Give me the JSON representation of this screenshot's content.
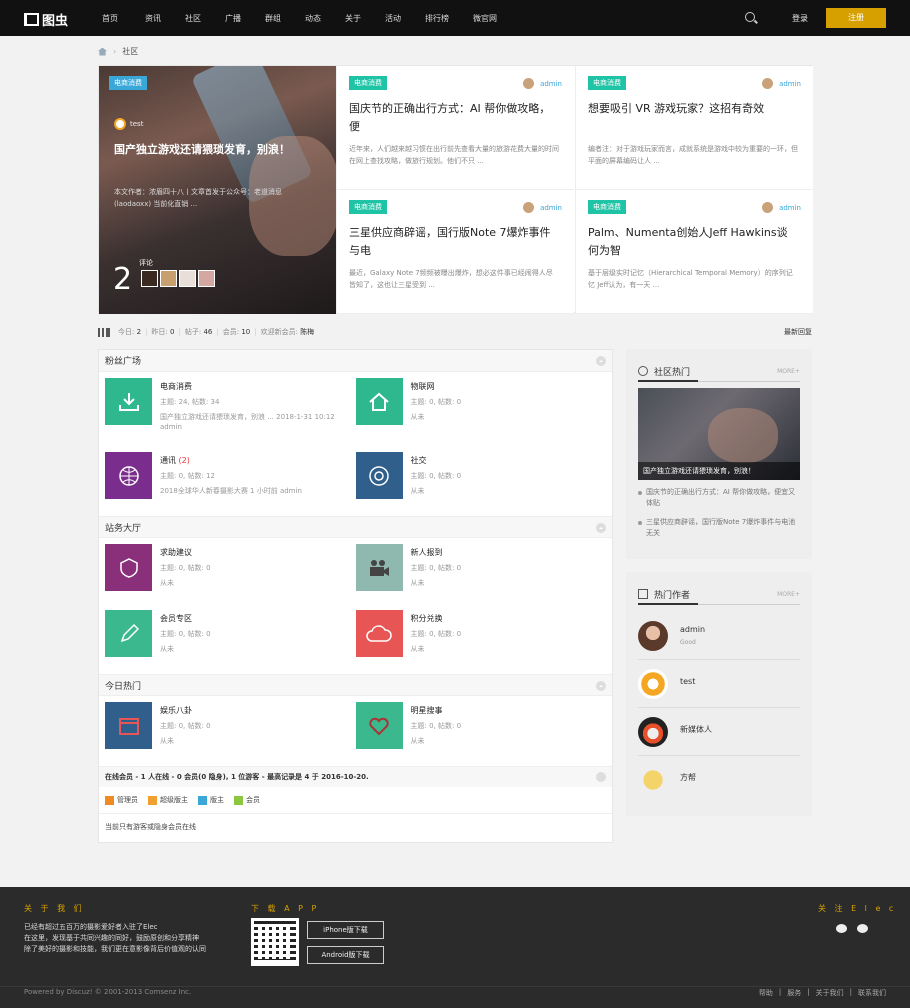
{
  "logo": "图虫",
  "nav": [
    "首页",
    "资讯",
    "社区",
    "广播",
    "群组",
    "动态",
    "关于",
    "活动",
    "排行榜",
    "微官网"
  ],
  "header": {
    "login": "登录",
    "register": "注册"
  },
  "breadcrumb": "社区",
  "hero": {
    "big": {
      "tag": "电商消费",
      "author": "test",
      "title": "国产独立游戏还请猥琐发育，别浪！",
      "desc": "本文作者：浓眉四十八丨文章首发于公众号：老道消息(laodaoxx) 当前化直销 ...",
      "comment_count": "2",
      "comment_label": "评论"
    },
    "cards": [
      {
        "tag": "电商消费",
        "user": "admin",
        "title": "国庆节的正确出行方式：AI 帮你做攻略，便",
        "desc": "近年来，人们越来越习惯在出行前先查看大量的旅游花费大量的时间在网上查找攻略，做旅行规划。他们不只 ..."
      },
      {
        "tag": "电商消费",
        "user": "admin",
        "title": "想要吸引 VR 游戏玩家？这招有奇效",
        "desc": "编者注：对于游戏玩家而言，成就系统是游戏中较为重要的一环，但平面的屏幕编码让人 ..."
      },
      {
        "tag": "电商消费",
        "user": "admin",
        "title": "三星供应商辟谣，国行版Note 7爆炸事件与电",
        "desc": "最近，Galaxy Note 7频频被曝出爆炸，想必这件事已经闹得人尽皆知了，这也让三星受到 ..."
      },
      {
        "tag": "电商消费",
        "user": "admin",
        "title": "Palm、Numenta创始人Jeff Hawkins谈何为智",
        "desc": "基于层级实时记忆（Hierarchical Temporal Memory）的序列记忆 Jeff认为，有一天 ..."
      }
    ]
  },
  "stats": {
    "today_label": "今日:",
    "today": "2",
    "yesterday_label": "昨日:",
    "yesterday": "0",
    "posts_label": "帖子:",
    "posts": "46",
    "members_label": "会员:",
    "members": "10",
    "welcome_label": "欢迎新会员:",
    "newest": "陈梅",
    "latest_reply": "最新回复"
  },
  "sections": [
    {
      "title": "粉丝广场",
      "forums": [
        {
          "name": "电商消费",
          "count": "",
          "meta": "主题: 24, 帖数: 34",
          "last": "国产独立游戏还请猥琐发育，别浪 ... 2018-1-31 10:12 admin",
          "color": "#2fb88e",
          "icon": "download-icon"
        },
        {
          "name": "物联网",
          "count": "",
          "meta": "主题: 0, 帖数: 0",
          "last": "从未",
          "color": "#2fb88e",
          "icon": "home-icon"
        },
        {
          "name": "通讯",
          "count": "(2)",
          "meta": "主题: 0, 帖数: 12",
          "last": "2018全球华人新春摄影大赛 1 小时前 admin",
          "color": "#7b2d8e",
          "icon": "globe-icon"
        },
        {
          "name": "社交",
          "count": "",
          "meta": "主题: 0, 帖数: 0",
          "last": "从未",
          "color": "#2f5f8a",
          "icon": "at-icon"
        }
      ]
    },
    {
      "title": "站务大厅",
      "forums": [
        {
          "name": "求助建议",
          "count": "",
          "meta": "主题: 0, 帖数: 0",
          "last": "从未",
          "color": "#8a2f7a",
          "icon": "heart-shield-icon"
        },
        {
          "name": "新人报到",
          "count": "",
          "meta": "主题: 0, 帖数: 0",
          "last": "从未",
          "color": "#8fb8ae",
          "icon": "camera-icon"
        },
        {
          "name": "会员专区",
          "count": "",
          "meta": "主题: 0, 帖数: 0",
          "last": "从未",
          "color": "#3bb88e",
          "icon": "pencil-icon"
        },
        {
          "name": "积分兑换",
          "count": "",
          "meta": "主题: 0, 帖数: 0",
          "last": "从未",
          "color": "#e85555",
          "icon": "cloud-icon"
        }
      ]
    },
    {
      "title": "今日热门",
      "forums": [
        {
          "name": "娱乐八卦",
          "count": "",
          "meta": "主题: 0, 帖数: 0",
          "last": "从未",
          "color": "#2f5f8a",
          "icon": "calendar-icon"
        },
        {
          "name": "明星搜事",
          "count": "",
          "meta": "主题: 0, 帖数: 0",
          "last": "从未",
          "color": "#3bb88e",
          "icon": "heart-icon"
        }
      ]
    }
  ],
  "online": {
    "summary": "在线会员 - 1 人在线 - 0 会员(0 隐身), 1 位游客 - 最高记录是 4 于 2016-10-20.",
    "legend": [
      {
        "label": "管理员",
        "color": "#f08a24"
      },
      {
        "label": "超级版主",
        "color": "#f0a030"
      },
      {
        "label": "版主",
        "color": "#3aa7d9"
      },
      {
        "label": "会员",
        "color": "#8cc63f"
      }
    ],
    "note": "当前只有游客或隐身会员在线"
  },
  "hot": {
    "title": "社区热门",
    "more": "MORE+",
    "image_caption": "国产独立游戏还请猥琐发育，别浪！",
    "items": [
      "国庆节的正确出行方式：AI 帮你做攻略，便宜又体贴",
      "三星供应商辟谣，国行版Note 7爆炸事件与电池无关"
    ]
  },
  "authors": {
    "title": "热门作者",
    "more": "MORE+",
    "list": [
      {
        "name": "admin",
        "sub": "Good"
      },
      {
        "name": "test",
        "sub": ""
      },
      {
        "name": "新媒体人",
        "sub": ""
      },
      {
        "name": "方帮",
        "sub": ""
      }
    ]
  },
  "footer": {
    "about_title": "关 于 我 们",
    "about_lines": [
      "已经有超过五百万的摄影爱好者入驻了Elec",
      "在这里，发现基于共同兴趣的同好，鼓励原创和分享精神",
      "除了美好的摄影和技能，我们更在意影像背后价值观的认同"
    ],
    "app_title": "下 载 A P P",
    "iphone": "iPhone版下载",
    "android": "Android版下载",
    "follow_title": "关 注 E l e c",
    "copyright": "Powered by Discuz! © 2001-2013 Comsenz Inc.",
    "links": [
      "帮助",
      "|",
      "服务",
      "|",
      "关于我们",
      "|",
      "联系我们"
    ]
  }
}
